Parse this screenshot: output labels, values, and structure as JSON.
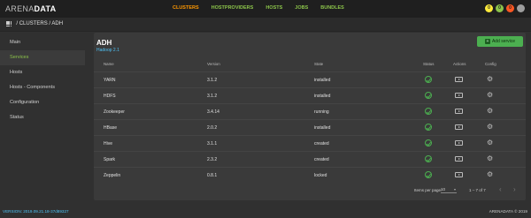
{
  "brand": {
    "part1": "ARENA",
    "part2": "DATA"
  },
  "nav": [
    {
      "label": "CLUSTERS",
      "active": true
    },
    {
      "label": "HOSTPROVIDERS",
      "active": false
    },
    {
      "label": "HOSTS",
      "active": false
    },
    {
      "label": "JOBS",
      "active": false
    },
    {
      "label": "BUNDLES",
      "active": false
    }
  ],
  "badges": [
    {
      "text": "0",
      "color": "#ffeb3b"
    },
    {
      "text": "0",
      "color": "#8bc34a"
    },
    {
      "text": "0",
      "color": "#ff5722"
    },
    {
      "text": "",
      "color": "#9e9e9e"
    }
  ],
  "breadcrumb": {
    "text": "/ CLUSTERS / ADH"
  },
  "sidebar": {
    "items": [
      {
        "label": "Main",
        "active": false
      },
      {
        "label": "Services",
        "active": true
      },
      {
        "label": "Hosts",
        "active": false
      },
      {
        "label": "Hosts - Components",
        "active": false
      },
      {
        "label": "Configuration",
        "active": false
      },
      {
        "label": "Status",
        "active": false
      }
    ]
  },
  "panel": {
    "title": "ADH",
    "subtitle": "Hadoop 2.1",
    "add_button": "Add service"
  },
  "table": {
    "headers": {
      "name": "Name",
      "version": "Version",
      "state": "State",
      "status": "Status",
      "actions": "Actions",
      "config": "Config"
    },
    "rows": [
      {
        "name": "YARN",
        "version": "3.1.2",
        "state": "installed"
      },
      {
        "name": "HDFS",
        "version": "3.1.2",
        "state": "installed"
      },
      {
        "name": "Zookeeper",
        "version": "3.4.14",
        "state": "running"
      },
      {
        "name": "HBase",
        "version": "2.0.2",
        "state": "installed"
      },
      {
        "name": "Hive",
        "version": "3.1.1",
        "state": "created"
      },
      {
        "name": "Spark",
        "version": "2.3.2",
        "state": "created"
      },
      {
        "name": "Zeppelin",
        "version": "0.8.1",
        "state": "locked"
      }
    ]
  },
  "pager": {
    "items_per_page_label": "Items per page:",
    "items_per_page_value": "10",
    "range": "1 – 7 of 7"
  },
  "footer": {
    "version": "VERSION: 2019.09.21.18-37d89327",
    "copyright": "ARENADATA © 2019"
  },
  "colors": {
    "accent_green": "#8bc34a",
    "active_nav": "#ff9800",
    "link_blue": "#4fc3f7"
  }
}
